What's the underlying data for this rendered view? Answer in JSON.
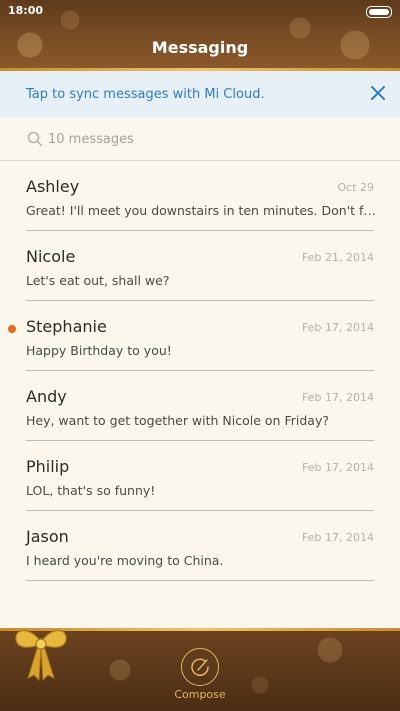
{
  "status_bar": {
    "time": "18:00"
  },
  "header": {
    "title": "Messaging"
  },
  "sync_banner": {
    "text": "Tap to sync messages with Mi Cloud."
  },
  "search": {
    "count_text": "10 messages"
  },
  "messages": [
    {
      "name": "Ashley",
      "date": "Oct 29",
      "preview": "Great! I'll meet you downstairs in ten minutes. Don't forget...",
      "unread": false
    },
    {
      "name": "Nicole",
      "date": "Feb 21, 2014",
      "preview": "Let's eat out, shall we?",
      "unread": false
    },
    {
      "name": "Stephanie",
      "date": "Feb 17, 2014",
      "preview": "Happy Birthday to you!",
      "unread": true
    },
    {
      "name": "Andy",
      "date": "Feb 17, 2014",
      "preview": "Hey, want to get together with Nicole on Friday?",
      "unread": false
    },
    {
      "name": "Philip",
      "date": "Feb 17, 2014",
      "preview": "LOL, that's so funny!",
      "unread": false
    },
    {
      "name": "Jason",
      "date": "Feb 17, 2014",
      "preview": "I heard you're moving to China.",
      "unread": false
    }
  ],
  "bottom_bar": {
    "compose_label": "Compose"
  },
  "icons": {
    "close": "close-icon",
    "search": "search-icon",
    "compose": "compose-icon",
    "bow": "gift-bow-icon",
    "battery": "battery-icon"
  },
  "colors": {
    "accent_blue": "#2a7ec9",
    "unread_dot": "#ec6a1b",
    "gold": "#e6b35e"
  }
}
